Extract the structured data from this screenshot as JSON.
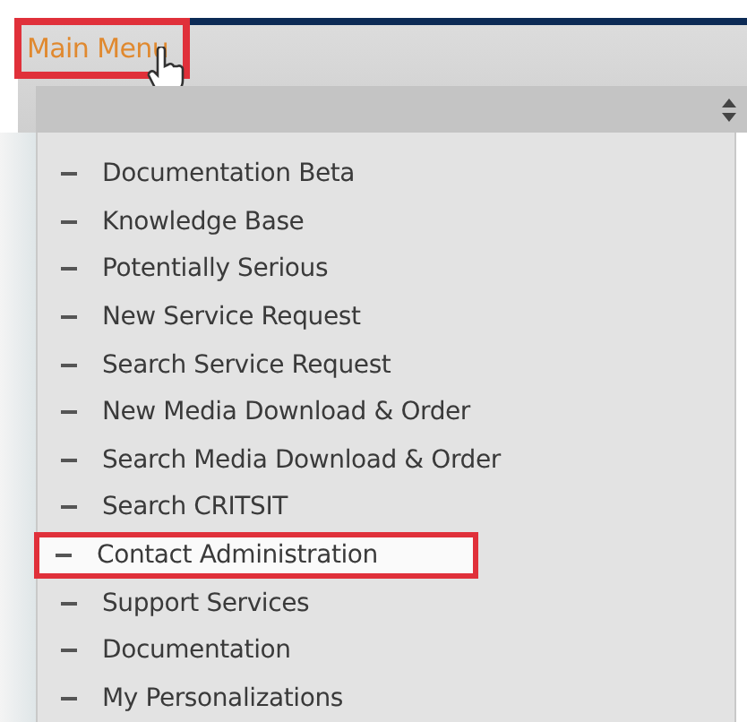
{
  "main_menu": {
    "label": "Main Menu",
    "highlighted": true
  },
  "menu_items": [
    {
      "label": "Documentation Beta",
      "highlighted": false
    },
    {
      "label": "Knowledge Base",
      "highlighted": false
    },
    {
      "label": "Potentially Serious",
      "highlighted": false
    },
    {
      "label": "New Service Request",
      "highlighted": false
    },
    {
      "label": "Search Service Request",
      "highlighted": false
    },
    {
      "label": "New Media Download & Order",
      "highlighted": false
    },
    {
      "label": "Search Media Download & Order",
      "highlighted": false
    },
    {
      "label": "Search CRITSIT",
      "highlighted": false
    },
    {
      "label": "Contact Administration",
      "highlighted": true
    },
    {
      "label": "Support Services",
      "highlighted": false
    },
    {
      "label": "Documentation",
      "highlighted": false
    },
    {
      "label": "My Personalizations",
      "highlighted": false
    }
  ]
}
